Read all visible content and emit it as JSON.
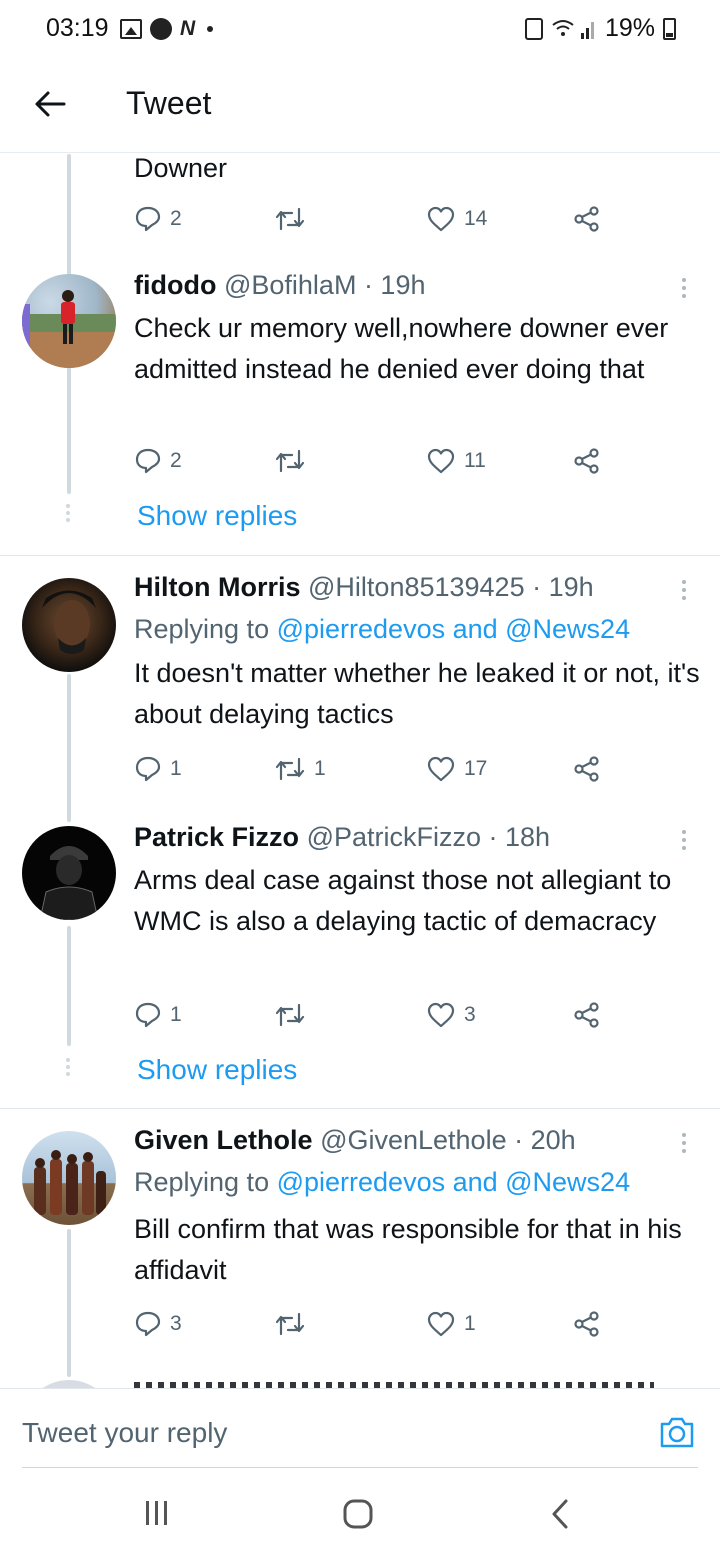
{
  "status_bar": {
    "time": "03:19",
    "battery": "19%"
  },
  "header": {
    "title": "Tweet"
  },
  "partial_tweet": {
    "text": "Downer",
    "replies": "2",
    "retweets": "",
    "likes": "14"
  },
  "tweets": [
    {
      "name": "fidodo",
      "meta": "@BofihlaM · 19h",
      "text": "Check ur memory well,nowhere downer ever admitted instead he denied ever doing that",
      "replies": "2",
      "retweets": "",
      "likes": "11",
      "show_replies": "Show replies"
    },
    {
      "name": "Hilton Morris",
      "meta": "@Hilton85139425 · 19h",
      "replying_prefix": "Replying to ",
      "replying_to": "@pierredevos and @News24",
      "text": "It doesn't matter whether he leaked it or not, it's about delaying tactics",
      "replies": "1",
      "retweets": "1",
      "likes": "17"
    },
    {
      "name": "Patrick Fizzo",
      "meta": "@PatrickFizzo · 18h",
      "text": "Arms deal case against those not allegiant to WMC is also a delaying tactic of demacracy",
      "replies": "1",
      "retweets": "",
      "likes": "3",
      "show_replies": "Show replies"
    },
    {
      "name": "Given Lethole",
      "meta": "@GivenLethole · 20h",
      "replying_prefix": "Replying to ",
      "replying_to": "@pierredevos and @News24",
      "text": "Bill confirm that was responsible for that in his affidavit",
      "replies": "3",
      "retweets": "",
      "likes": "1"
    }
  ],
  "reply_bar": {
    "placeholder": "Tweet your reply"
  },
  "colors": {
    "link": "#1d9bf0",
    "text": "#0f1419",
    "muted": "#536471",
    "line": "#cfd9de"
  },
  "icons": [
    "back-arrow-icon",
    "reply-icon",
    "retweet-icon",
    "like-icon",
    "share-icon",
    "more-icon",
    "camera-icon",
    "recents-icon",
    "home-icon",
    "back-icon"
  ]
}
